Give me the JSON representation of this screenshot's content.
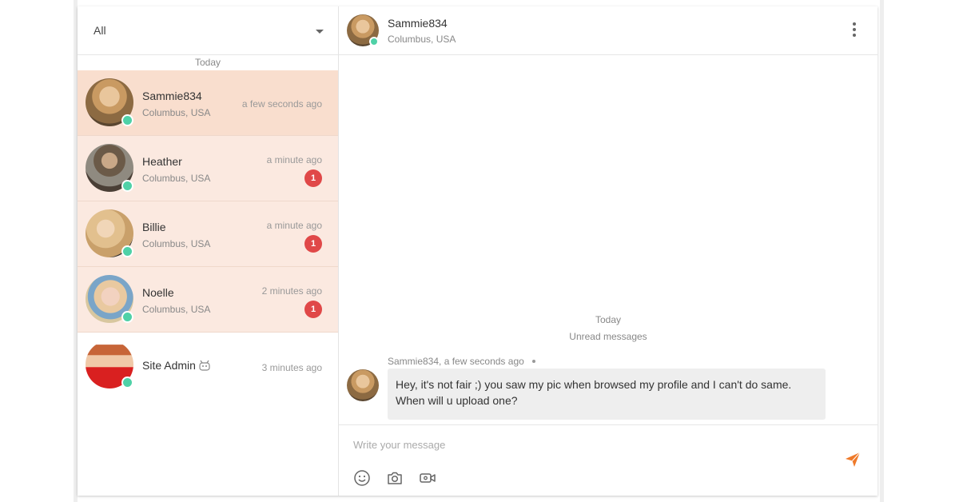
{
  "sidebar": {
    "filter_label": "All",
    "day_label": "Today",
    "conversations": [
      {
        "name": "Sammie834",
        "location": "Columbus, USA",
        "time": "a few seconds ago",
        "badge": ""
      },
      {
        "name": "Heather",
        "location": "Columbus, USA",
        "time": "a minute ago",
        "badge": "1"
      },
      {
        "name": "Billie",
        "location": "Columbus, USA",
        "time": "a minute ago",
        "badge": "1"
      },
      {
        "name": "Noelle",
        "location": "Columbus, USA",
        "time": "2 minutes ago",
        "badge": "1"
      },
      {
        "name": "Site Admin",
        "location": "",
        "time": "3 minutes ago",
        "badge": ""
      }
    ]
  },
  "chat": {
    "header": {
      "name": "Sammie834",
      "location": "Columbus, USA"
    },
    "day_label": "Today",
    "unread_label": "Unread messages",
    "message": {
      "sender": "Sammie834,",
      "time": "a few seconds ago",
      "line1": "Hey, it's not fair ;) you saw my pic when browsed my profile and I can't do same.",
      "line2": "When will u upload one?"
    },
    "composer": {
      "placeholder": "Write your message",
      "value": ""
    }
  },
  "icons": {
    "dropdown": "chevron-down-icon",
    "menu": "more-vertical-icon",
    "emoji": "smiley-icon",
    "camera": "camera-icon",
    "video": "video-camera-icon",
    "send": "send-icon",
    "admin": "robot-icon"
  },
  "colors": {
    "online_status": "#4fd1a7",
    "active_row": "#f9dece",
    "unread_row": "#fbe9e0",
    "badge": "#e04848",
    "send_accent": "#ef7a2a"
  }
}
